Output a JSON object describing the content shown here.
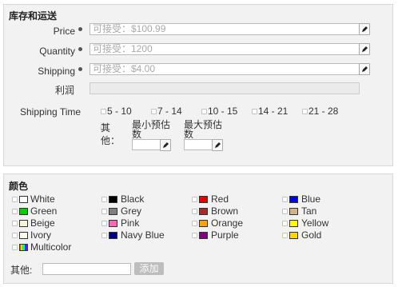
{
  "inventory": {
    "title": "库存和运送",
    "fields": [
      {
        "label": "Price",
        "placeholder": "可接受：$100.99"
      },
      {
        "label": "Quantity",
        "placeholder": "可接受：1200"
      },
      {
        "label": "Shipping",
        "placeholder": "可接受：$4.00"
      }
    ],
    "profit_label": "利润",
    "shipping_time": {
      "label": "Shipping Time",
      "options": [
        "5 - 10",
        "7 - 14",
        "10 - 15",
        "14 - 21",
        "21 - 28"
      ],
      "other_label": "其他：",
      "min_label": "最小预估数",
      "max_label": "最大预估数"
    }
  },
  "colors": {
    "title": "颜色",
    "items": [
      {
        "name": "White",
        "hex": "#ffffff"
      },
      {
        "name": "Black",
        "hex": "#000000"
      },
      {
        "name": "Red",
        "hex": "#e00000"
      },
      {
        "name": "Blue",
        "hex": "#0000e0"
      },
      {
        "name": "Green",
        "hex": "#00cc00"
      },
      {
        "name": "Grey",
        "hex": "#808080"
      },
      {
        "name": "Brown",
        "hex": "#a52a2a"
      },
      {
        "name": "Tan",
        "hex": "#d2b48c"
      },
      {
        "name": "Beige",
        "hex": "#f5f5dc"
      },
      {
        "name": "Pink",
        "hex": "#ff69b4"
      },
      {
        "name": "Orange",
        "hex": "#ffa500"
      },
      {
        "name": "Yellow",
        "hex": "#ffff00"
      },
      {
        "name": "Ivory",
        "hex": "#fffff0"
      },
      {
        "name": "Navy Blue",
        "hex": "#000080"
      },
      {
        "name": "Purple",
        "hex": "#800080"
      },
      {
        "name": "Gold",
        "hex": "#ffd700"
      },
      {
        "name": "Multicolor",
        "hex": "multicolor"
      }
    ],
    "other_label": "其他:",
    "add_button": "添加"
  }
}
